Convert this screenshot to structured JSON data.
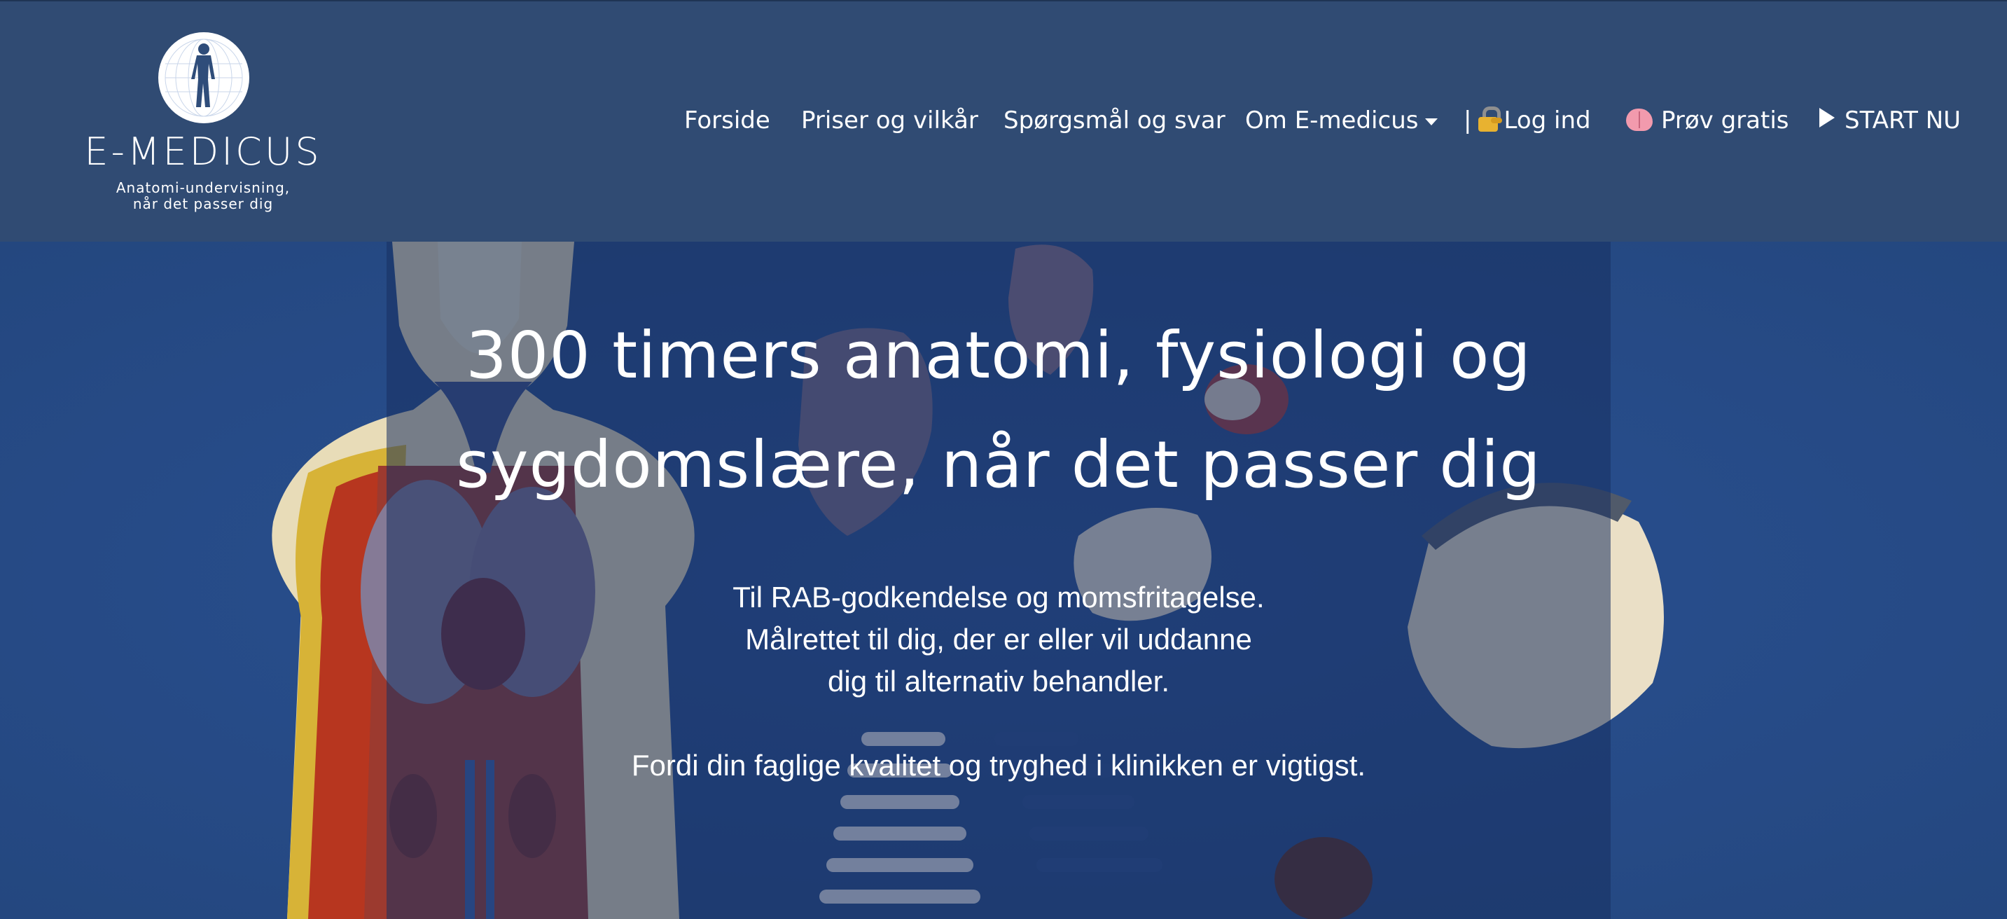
{
  "brand": {
    "name": "E-MEDICUS",
    "tagline_line1": "Anatomi-undervisning,",
    "tagline_line2": "når det passer dig"
  },
  "nav": {
    "items": [
      {
        "label": "Forside"
      },
      {
        "label": "Priser og vilkår"
      },
      {
        "label": "Spørgsmål og svar"
      },
      {
        "label": "Om E-medicus",
        "icon": "chevron-down-icon"
      },
      {
        "prefix": "|",
        "icon": "lock-icon",
        "label": "Log ind"
      },
      {
        "icon": "brain-icon",
        "label": "Prøv gratis"
      },
      {
        "icon": "play-icon",
        "label": "START NU"
      }
    ]
  },
  "hero": {
    "title_line1": "300 timers anatomi, fysiologi og",
    "title_line2": "sygdomslære, når det passer dig",
    "text_line1": "Til RAB-godkendelse og momsfritagelse.",
    "text_line2": "Målrettet til dig, der er eller vil uddanne",
    "text_line3": "dig til alternativ behandler.",
    "text_line4": "Fordi din faglige kvalitet og tryghed i klinikken er vigtigst."
  },
  "colors": {
    "header_bg": "#304b73",
    "hero_bg": "#284d8d",
    "text": "#ffffff"
  }
}
